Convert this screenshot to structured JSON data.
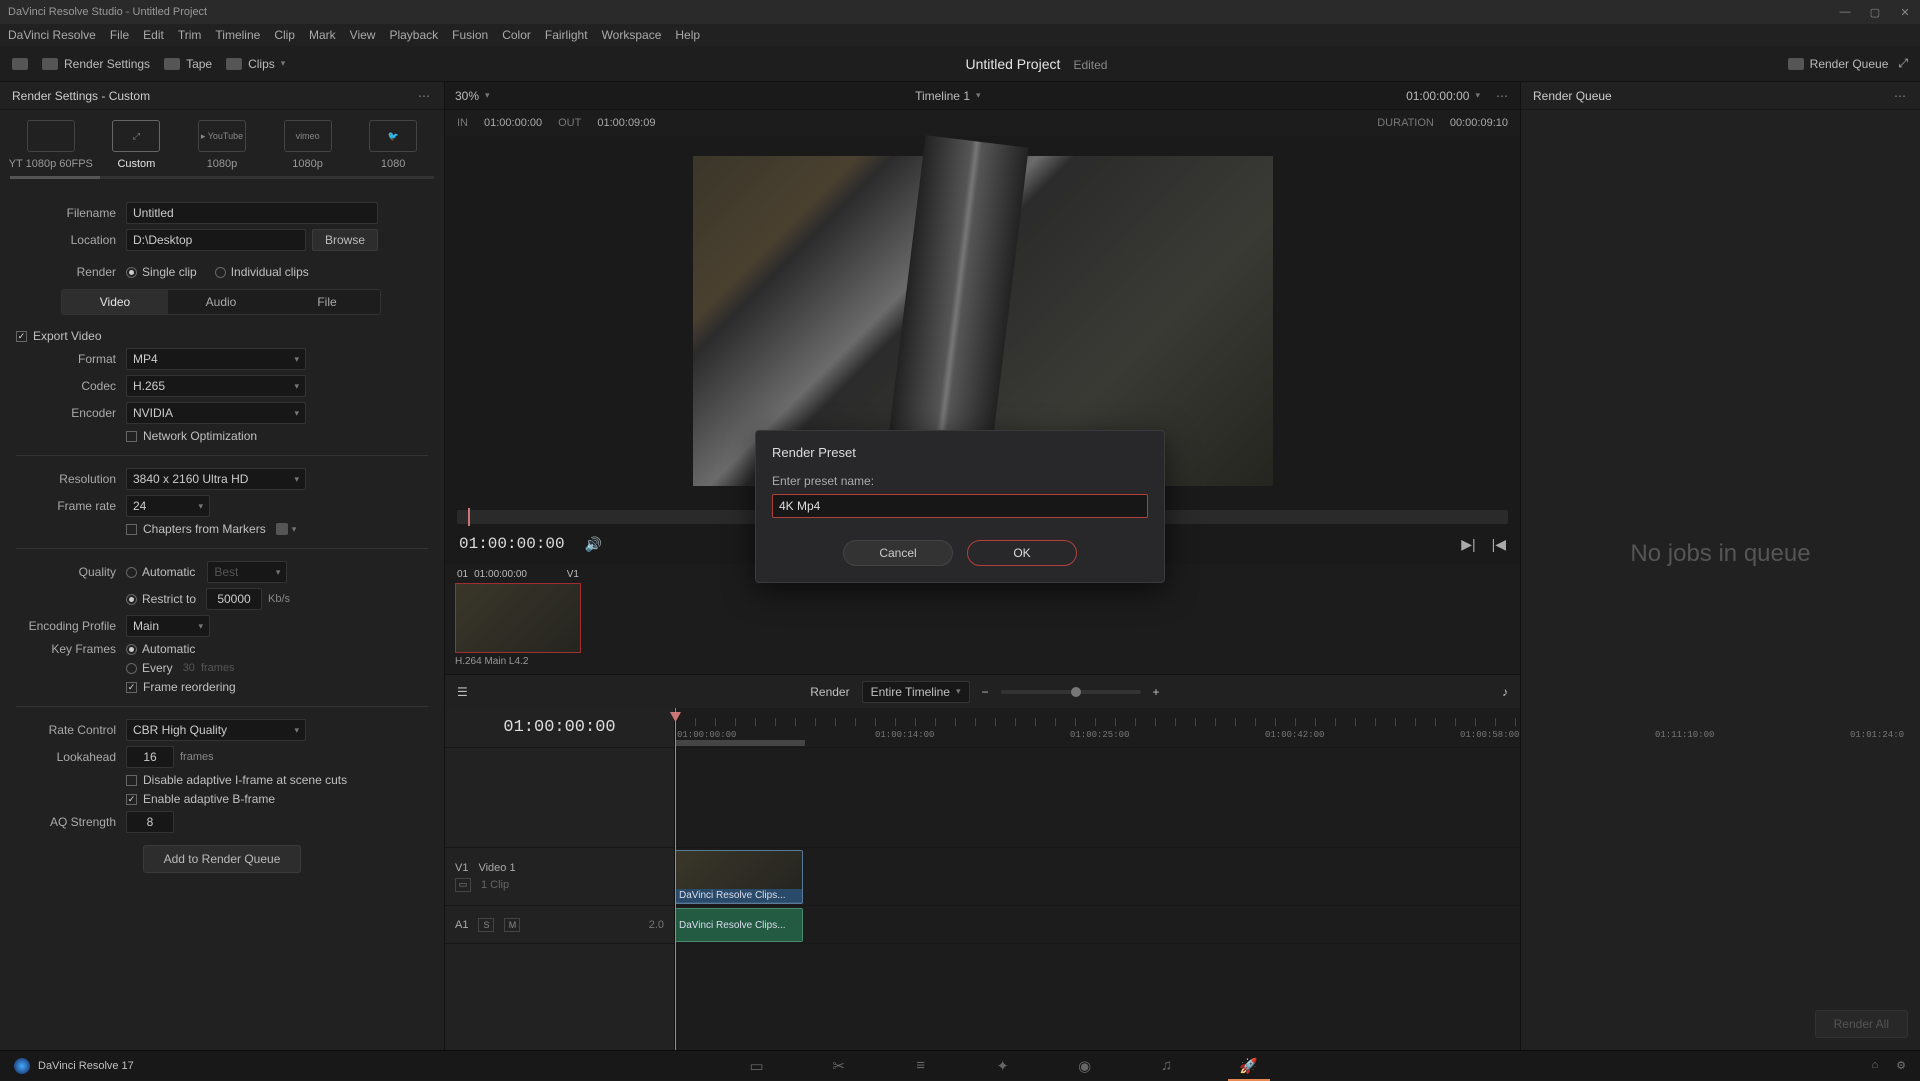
{
  "titlebar": {
    "title": "DaVinci Resolve Studio - Untitled Project"
  },
  "menubar": [
    "DaVinci Resolve",
    "File",
    "Edit",
    "Trim",
    "Timeline",
    "Clip",
    "Mark",
    "View",
    "Playback",
    "Fusion",
    "Color",
    "Fairlight",
    "Workspace",
    "Help"
  ],
  "toolbar": {
    "render_settings": "Render Settings",
    "tape": "Tape",
    "clips": "Clips",
    "project": "Untitled Project",
    "edited": "Edited",
    "render_queue": "Render Queue"
  },
  "left": {
    "header": "Render Settings - Custom",
    "presets": [
      {
        "label": "YT 1080p 60FPS",
        "icon": ""
      },
      {
        "label": "Custom",
        "icon": ""
      },
      {
        "label": "1080p",
        "icon": "▸ YouTube"
      },
      {
        "label": "1080p",
        "icon": "vimeo"
      },
      {
        "label": "1080",
        "icon": ""
      }
    ],
    "filename_label": "Filename",
    "filename": "Untitled",
    "location_label": "Location",
    "location": "D:\\Desktop",
    "browse": "Browse",
    "render_label": "Render",
    "single_clip": "Single clip",
    "individual": "Individual clips",
    "tabs": {
      "video": "Video",
      "audio": "Audio",
      "file": "File"
    },
    "export_video": "Export Video",
    "format_label": "Format",
    "format": "MP4",
    "codec_label": "Codec",
    "codec": "H.265",
    "encoder_label": "Encoder",
    "encoder": "NVIDIA",
    "net_opt": "Network Optimization",
    "resolution_label": "Resolution",
    "resolution": "3840 x 2160 Ultra HD",
    "framerate_label": "Frame rate",
    "framerate": "24",
    "chapters": "Chapters from Markers",
    "quality_label": "Quality",
    "quality_auto": "Automatic",
    "quality_best": "Best",
    "restrict_to": "Restrict to",
    "restrict_val": "50000",
    "kbs": "Kb/s",
    "enc_profile_label": "Encoding Profile",
    "enc_profile": "Main",
    "keyframes_label": "Key Frames",
    "kf_auto": "Automatic",
    "kf_every": "Every",
    "kf_num": "30",
    "kf_frames": "frames",
    "frame_reorder": "Frame reordering",
    "rate_ctrl_label": "Rate Control",
    "rate_ctrl": "CBR High Quality",
    "lookahead_label": "Lookahead",
    "lookahead": "16",
    "frames_unit": "frames",
    "disable_iframe": "Disable adaptive I-frame at scene cuts",
    "enable_bframe": "Enable adaptive B-frame",
    "aq_label": "AQ Strength",
    "aq_val": "8",
    "add_queue": "Add to Render Queue"
  },
  "viewer": {
    "zoom": "30%",
    "timeline": "Timeline 1",
    "tc_current": "01:00:00:00",
    "in_label": "IN",
    "in_tc": "01:00:00:00",
    "out_label": "OUT",
    "out_tc": "01:00:09:09",
    "dur_label": "DURATION",
    "dur_tc": "00:00:09:10",
    "transport_tc": "01:00:00:00",
    "clip": {
      "head_num": "01",
      "head_tc": "01:00:00:00",
      "head_trk": "V1",
      "label": "H.264 Main L4.2"
    }
  },
  "timeline": {
    "render_label": "Render",
    "range": "Entire Timeline",
    "tc": "01:00:00:00",
    "ticks": [
      "01:00:00:00",
      "01:00:14:00",
      "01:00:25:00",
      "01:00:42:00",
      "01:00:58:00",
      "01:11:10:00",
      "01:01:24:0"
    ],
    "v1": {
      "id": "V1",
      "name": "Video 1",
      "clip_count": "1 Clip"
    },
    "a1": {
      "id": "A1",
      "val": "2.0"
    },
    "clip_name": "DaVinci Resolve Clips..."
  },
  "right": {
    "header": "Render Queue",
    "empty": "No jobs in queue",
    "render_all": "Render All"
  },
  "modal": {
    "title": "Render Preset",
    "label": "Enter preset name:",
    "value": "4K Mp4",
    "cancel": "Cancel",
    "ok": "OK"
  },
  "status": {
    "app": "DaVinci Resolve 17"
  }
}
